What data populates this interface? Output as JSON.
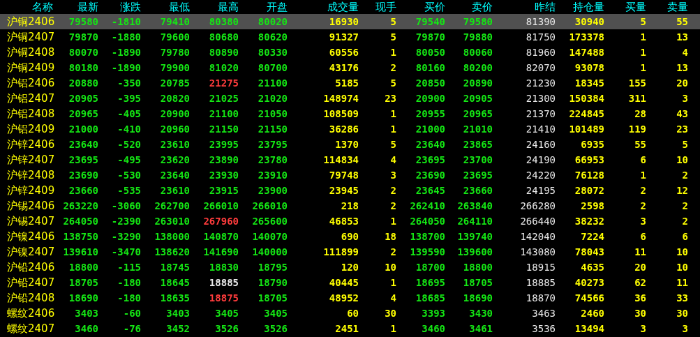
{
  "table": {
    "columns": [
      {
        "label": "名称",
        "kind": "name"
      },
      {
        "label": "最新",
        "kind": "price"
      },
      {
        "label": "涨跌",
        "kind": "price"
      },
      {
        "label": "最低",
        "kind": "price"
      },
      {
        "label": "最高",
        "kind": "price"
      },
      {
        "label": "开盘",
        "kind": "price"
      },
      {
        "label": "成交量",
        "kind": "volume"
      },
      {
        "label": "现手",
        "kind": "volume"
      },
      {
        "label": "买价",
        "kind": "price"
      },
      {
        "label": "卖价",
        "kind": "price"
      },
      {
        "label": "昨结",
        "kind": "settle"
      },
      {
        "label": "持仓量",
        "kind": "volume"
      },
      {
        "label": "买量",
        "kind": "volume"
      },
      {
        "label": "卖量",
        "kind": "volume"
      }
    ],
    "rows": [
      {
        "selected": true,
        "cells": [
          "沪铜2406",
          {
            "text": "79580",
            "color": "#14e614"
          },
          {
            "text": "-1810",
            "color": "#14e614"
          },
          {
            "text": "79410",
            "color": "#14e614"
          },
          {
            "text": "80380",
            "color": "#14e614"
          },
          {
            "text": "80020",
            "color": "#14e614"
          },
          "16930",
          "5",
          {
            "text": "79540",
            "color": "#14e614"
          },
          {
            "text": "79580",
            "color": "#14e614"
          },
          "81390",
          "30940",
          "5",
          "55"
        ]
      },
      {
        "selected": false,
        "cells": [
          "沪铜2407",
          {
            "text": "79870",
            "color": "#14e614"
          },
          {
            "text": "-1880",
            "color": "#14e614"
          },
          {
            "text": "79600",
            "color": "#14e614"
          },
          {
            "text": "80680",
            "color": "#14e614"
          },
          {
            "text": "80620",
            "color": "#14e614"
          },
          "91327",
          "5",
          {
            "text": "79870",
            "color": "#14e614"
          },
          {
            "text": "79880",
            "color": "#14e614"
          },
          "81750",
          "173378",
          "1",
          "13"
        ]
      },
      {
        "selected": false,
        "cells": [
          "沪铜2408",
          {
            "text": "80070",
            "color": "#14e614"
          },
          {
            "text": "-1890",
            "color": "#14e614"
          },
          {
            "text": "79780",
            "color": "#14e614"
          },
          {
            "text": "80890",
            "color": "#14e614"
          },
          {
            "text": "80330",
            "color": "#14e614"
          },
          "60556",
          "1",
          {
            "text": "80050",
            "color": "#14e614"
          },
          {
            "text": "80060",
            "color": "#14e614"
          },
          "81960",
          "147488",
          "1",
          "4"
        ]
      },
      {
        "selected": false,
        "cells": [
          "沪铜2409",
          {
            "text": "80180",
            "color": "#14e614"
          },
          {
            "text": "-1890",
            "color": "#14e614"
          },
          {
            "text": "79900",
            "color": "#14e614"
          },
          {
            "text": "81020",
            "color": "#14e614"
          },
          {
            "text": "80700",
            "color": "#14e614"
          },
          "43176",
          "2",
          {
            "text": "80160",
            "color": "#14e614"
          },
          {
            "text": "80200",
            "color": "#14e614"
          },
          "82070",
          "93078",
          "1",
          "13"
        ]
      },
      {
        "selected": false,
        "cells": [
          "沪铝2406",
          {
            "text": "20880",
            "color": "#14e614"
          },
          {
            "text": "-350",
            "color": "#14e614"
          },
          {
            "text": "20785",
            "color": "#14e614"
          },
          {
            "text": "21275",
            "color": "#ff3c3c"
          },
          {
            "text": "21100",
            "color": "#14e614"
          },
          "5185",
          "5",
          {
            "text": "20850",
            "color": "#14e614"
          },
          {
            "text": "20890",
            "color": "#14e614"
          },
          "21230",
          "18345",
          "155",
          "20"
        ]
      },
      {
        "selected": false,
        "cells": [
          "沪铝2407",
          {
            "text": "20905",
            "color": "#14e614"
          },
          {
            "text": "-395",
            "color": "#14e614"
          },
          {
            "text": "20820",
            "color": "#14e614"
          },
          {
            "text": "21025",
            "color": "#14e614"
          },
          {
            "text": "21020",
            "color": "#14e614"
          },
          "148974",
          "23",
          {
            "text": "20900",
            "color": "#14e614"
          },
          {
            "text": "20905",
            "color": "#14e614"
          },
          "21300",
          "150384",
          "311",
          "3"
        ]
      },
      {
        "selected": false,
        "cells": [
          "沪铝2408",
          {
            "text": "20965",
            "color": "#14e614"
          },
          {
            "text": "-405",
            "color": "#14e614"
          },
          {
            "text": "20900",
            "color": "#14e614"
          },
          {
            "text": "21100",
            "color": "#14e614"
          },
          {
            "text": "21050",
            "color": "#14e614"
          },
          "108509",
          "1",
          {
            "text": "20955",
            "color": "#14e614"
          },
          {
            "text": "20965",
            "color": "#14e614"
          },
          "21370",
          "224845",
          "28",
          "43"
        ]
      },
      {
        "selected": false,
        "cells": [
          "沪铝2409",
          {
            "text": "21000",
            "color": "#14e614"
          },
          {
            "text": "-410",
            "color": "#14e614"
          },
          {
            "text": "20960",
            "color": "#14e614"
          },
          {
            "text": "21150",
            "color": "#14e614"
          },
          {
            "text": "21150",
            "color": "#14e614"
          },
          "36286",
          "1",
          {
            "text": "21000",
            "color": "#14e614"
          },
          {
            "text": "21010",
            "color": "#14e614"
          },
          "21410",
          "101489",
          "119",
          "23"
        ]
      },
      {
        "selected": false,
        "cells": [
          "沪锌2406",
          {
            "text": "23640",
            "color": "#14e614"
          },
          {
            "text": "-520",
            "color": "#14e614"
          },
          {
            "text": "23610",
            "color": "#14e614"
          },
          {
            "text": "23995",
            "color": "#14e614"
          },
          {
            "text": "23795",
            "color": "#14e614"
          },
          "1370",
          "5",
          {
            "text": "23640",
            "color": "#14e614"
          },
          {
            "text": "23865",
            "color": "#14e614"
          },
          "24160",
          "6935",
          "55",
          "5"
        ]
      },
      {
        "selected": false,
        "cells": [
          "沪锌2407",
          {
            "text": "23695",
            "color": "#14e614"
          },
          {
            "text": "-495",
            "color": "#14e614"
          },
          {
            "text": "23620",
            "color": "#14e614"
          },
          {
            "text": "23890",
            "color": "#14e614"
          },
          {
            "text": "23780",
            "color": "#14e614"
          },
          "114834",
          "4",
          {
            "text": "23695",
            "color": "#14e614"
          },
          {
            "text": "23700",
            "color": "#14e614"
          },
          "24190",
          "66953",
          "6",
          "10"
        ]
      },
      {
        "selected": false,
        "cells": [
          "沪锌2408",
          {
            "text": "23690",
            "color": "#14e614"
          },
          {
            "text": "-530",
            "color": "#14e614"
          },
          {
            "text": "23640",
            "color": "#14e614"
          },
          {
            "text": "23930",
            "color": "#14e614"
          },
          {
            "text": "23910",
            "color": "#14e614"
          },
          "79748",
          "3",
          {
            "text": "23690",
            "color": "#14e614"
          },
          {
            "text": "23695",
            "color": "#14e614"
          },
          "24220",
          "76128",
          "1",
          "2"
        ]
      },
      {
        "selected": false,
        "cells": [
          "沪锌2409",
          {
            "text": "23660",
            "color": "#14e614"
          },
          {
            "text": "-535",
            "color": "#14e614"
          },
          {
            "text": "23610",
            "color": "#14e614"
          },
          {
            "text": "23915",
            "color": "#14e614"
          },
          {
            "text": "23900",
            "color": "#14e614"
          },
          "23945",
          "2",
          {
            "text": "23645",
            "color": "#14e614"
          },
          {
            "text": "23660",
            "color": "#14e614"
          },
          "24195",
          "28072",
          "2",
          "12"
        ]
      },
      {
        "selected": false,
        "cells": [
          "沪锡2406",
          {
            "text": "263220",
            "color": "#14e614"
          },
          {
            "text": "-3060",
            "color": "#14e614"
          },
          {
            "text": "262700",
            "color": "#14e614"
          },
          {
            "text": "266010",
            "color": "#14e614"
          },
          {
            "text": "266010",
            "color": "#14e614"
          },
          "218",
          "2",
          {
            "text": "262410",
            "color": "#14e614"
          },
          {
            "text": "263840",
            "color": "#14e614"
          },
          "266280",
          "2598",
          "2",
          "2"
        ]
      },
      {
        "selected": false,
        "cells": [
          "沪锡2407",
          {
            "text": "264050",
            "color": "#14e614"
          },
          {
            "text": "-2390",
            "color": "#14e614"
          },
          {
            "text": "263010",
            "color": "#14e614"
          },
          {
            "text": "267960",
            "color": "#ff3c3c"
          },
          {
            "text": "265600",
            "color": "#14e614"
          },
          "46853",
          "1",
          {
            "text": "264050",
            "color": "#14e614"
          },
          {
            "text": "264110",
            "color": "#14e614"
          },
          "266440",
          "38232",
          "3",
          "2"
        ]
      },
      {
        "selected": false,
        "cells": [
          "沪镍2406",
          {
            "text": "138750",
            "color": "#14e614"
          },
          {
            "text": "-3290",
            "color": "#14e614"
          },
          {
            "text": "138000",
            "color": "#14e614"
          },
          {
            "text": "140870",
            "color": "#14e614"
          },
          {
            "text": "140070",
            "color": "#14e614"
          },
          "690",
          "18",
          {
            "text": "138700",
            "color": "#14e614"
          },
          {
            "text": "139740",
            "color": "#14e614"
          },
          "142040",
          "7224",
          "6",
          "6"
        ]
      },
      {
        "selected": false,
        "cells": [
          "沪镍2407",
          {
            "text": "139610",
            "color": "#14e614"
          },
          {
            "text": "-3470",
            "color": "#14e614"
          },
          {
            "text": "138620",
            "color": "#14e614"
          },
          {
            "text": "141690",
            "color": "#14e614"
          },
          {
            "text": "140000",
            "color": "#14e614"
          },
          "111899",
          "2",
          {
            "text": "139590",
            "color": "#14e614"
          },
          {
            "text": "139600",
            "color": "#14e614"
          },
          "143080",
          "78043",
          "11",
          "10"
        ]
      },
      {
        "selected": false,
        "cells": [
          "沪铅2406",
          {
            "text": "18800",
            "color": "#14e614"
          },
          {
            "text": "-115",
            "color": "#14e614"
          },
          {
            "text": "18745",
            "color": "#14e614"
          },
          {
            "text": "18830",
            "color": "#14e614"
          },
          {
            "text": "18795",
            "color": "#14e614"
          },
          "120",
          "10",
          {
            "text": "18700",
            "color": "#14e614"
          },
          {
            "text": "18800",
            "color": "#14e614"
          },
          "18915",
          "4635",
          "20",
          "10"
        ]
      },
      {
        "selected": false,
        "cells": [
          "沪铅2407",
          {
            "text": "18705",
            "color": "#14e614"
          },
          {
            "text": "-180",
            "color": "#14e614"
          },
          {
            "text": "18645",
            "color": "#14e614"
          },
          {
            "text": "18885",
            "color": "#e8e8e8"
          },
          {
            "text": "18790",
            "color": "#14e614"
          },
          "40445",
          "1",
          {
            "text": "18695",
            "color": "#14e614"
          },
          {
            "text": "18705",
            "color": "#14e614"
          },
          "18885",
          "40273",
          "62",
          "11"
        ]
      },
      {
        "selected": false,
        "cells": [
          "沪铅2408",
          {
            "text": "18690",
            "color": "#14e614"
          },
          {
            "text": "-180",
            "color": "#14e614"
          },
          {
            "text": "18635",
            "color": "#14e614"
          },
          {
            "text": "18875",
            "color": "#ff3c3c"
          },
          {
            "text": "18705",
            "color": "#14e614"
          },
          "48952",
          "4",
          {
            "text": "18685",
            "color": "#14e614"
          },
          {
            "text": "18690",
            "color": "#14e614"
          },
          "18870",
          "74566",
          "36",
          "33"
        ]
      },
      {
        "selected": false,
        "cells": [
          "螺纹2406",
          {
            "text": "3403",
            "color": "#14e614"
          },
          {
            "text": "-60",
            "color": "#14e614"
          },
          {
            "text": "3403",
            "color": "#14e614"
          },
          {
            "text": "3405",
            "color": "#14e614"
          },
          {
            "text": "3405",
            "color": "#14e614"
          },
          "60",
          "30",
          {
            "text": "3393",
            "color": "#14e614"
          },
          {
            "text": "3430",
            "color": "#14e614"
          },
          "3463",
          "2460",
          "30",
          "30"
        ]
      },
      {
        "selected": false,
        "cells": [
          "螺纹2407",
          {
            "text": "3460",
            "color": "#14e614"
          },
          {
            "text": "-76",
            "color": "#14e614"
          },
          {
            "text": "3452",
            "color": "#14e614"
          },
          {
            "text": "3526",
            "color": "#14e614"
          },
          {
            "text": "3526",
            "color": "#14e614"
          },
          "2451",
          "1",
          {
            "text": "3460",
            "color": "#14e614"
          },
          {
            "text": "3461",
            "color": "#14e614"
          },
          "3536",
          "13494",
          "3",
          "3"
        ]
      }
    ]
  }
}
